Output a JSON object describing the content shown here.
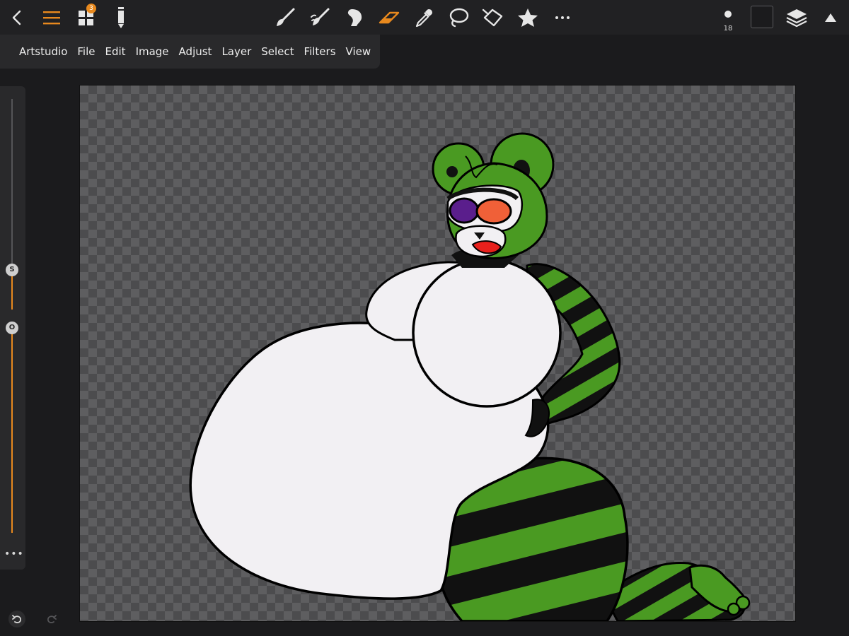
{
  "toolbar": {
    "layers_badge_count": "3",
    "brush_size": "18",
    "active_tool": "eraser",
    "tools": [
      "brush-icon",
      "smudge-icon",
      "bucket-icon",
      "eraser-icon",
      "eyedropper-icon",
      "lasso-icon",
      "transform-icon",
      "favorites-star-icon"
    ],
    "accent_color": "#e8891e",
    "current_color": "#1b1b1d"
  },
  "menu": {
    "items": [
      "Artstudio",
      "File",
      "Edit",
      "Image",
      "Adjust",
      "Layer",
      "Select",
      "Filters",
      "View"
    ]
  },
  "sliders": {
    "size_label": "S",
    "opacity_label": "O"
  },
  "canvas": {
    "background": "transparent-checkerboard",
    "artwork": "green and black striped bear character illustration",
    "colors": {
      "green": "#4a9a22",
      "black": "#111111",
      "white": "#f2f0f3",
      "purple": "#5a1e8c",
      "orange": "#f06038",
      "red": "#e8201c"
    }
  }
}
